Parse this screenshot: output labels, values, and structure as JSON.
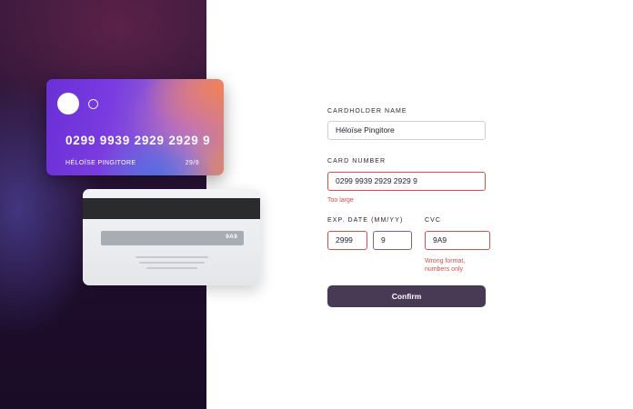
{
  "card_front": {
    "number": "0299 9939 2929 2929 9",
    "name": "HÉLOÏSE PINGITORE",
    "expiry": "29/9"
  },
  "card_back": {
    "cvc": "9A9"
  },
  "form": {
    "cardholder": {
      "label": "CARDHOLDER NAME",
      "value": "Héloïse Pingitore"
    },
    "card_number": {
      "label": "CARD NUMBER",
      "value": "0299 9939 2929 2929 9",
      "error": "Too large"
    },
    "exp_date": {
      "label": "EXP. DATE (MM/YY)",
      "month": "2999",
      "year": "9"
    },
    "cvc": {
      "label": "CVC",
      "value": "9A9",
      "error_line1": "Wrong format,",
      "error_line2": "numbers only"
    },
    "confirm_label": "Confirm"
  },
  "colors": {
    "error": "#e04a4a",
    "focus": "#7a5ad0",
    "button": "#483a55",
    "panel": "#1d0d2b"
  }
}
